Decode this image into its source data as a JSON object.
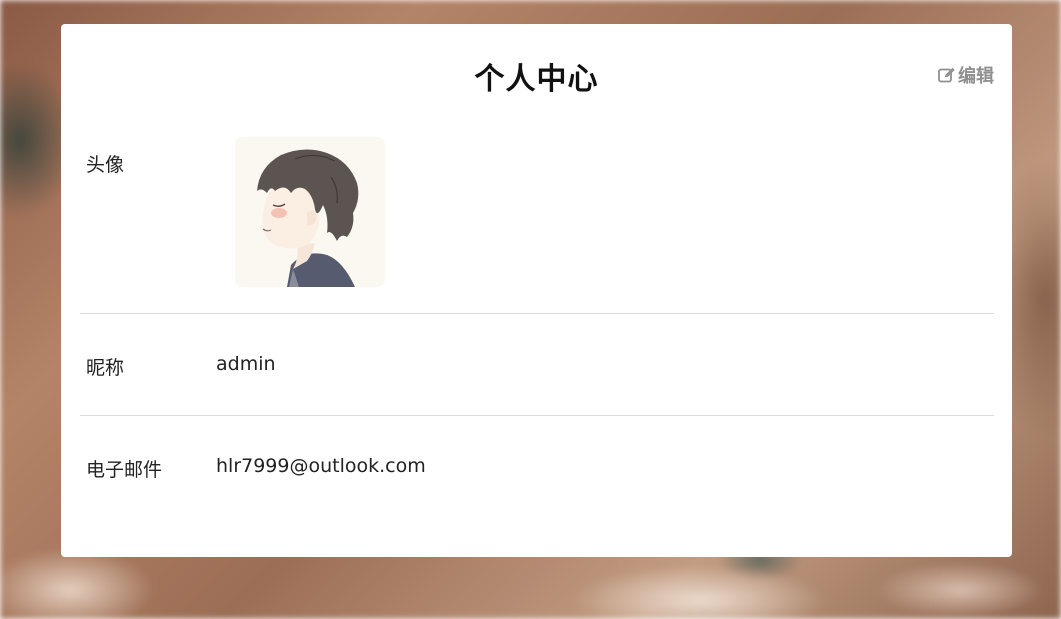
{
  "page": {
    "title": "个人中心",
    "edit_label": "编辑"
  },
  "profile": {
    "avatar_label": "头像",
    "nickname_label": "昵称",
    "nickname_value": "admin",
    "email_label": "电子邮件",
    "email_value": "hlr7999@outlook.com"
  },
  "icons": {
    "edit": "edit-icon"
  },
  "colors": {
    "card_bg": "#ffffff",
    "edit_text": "#909090",
    "divider": "#dddddd"
  }
}
